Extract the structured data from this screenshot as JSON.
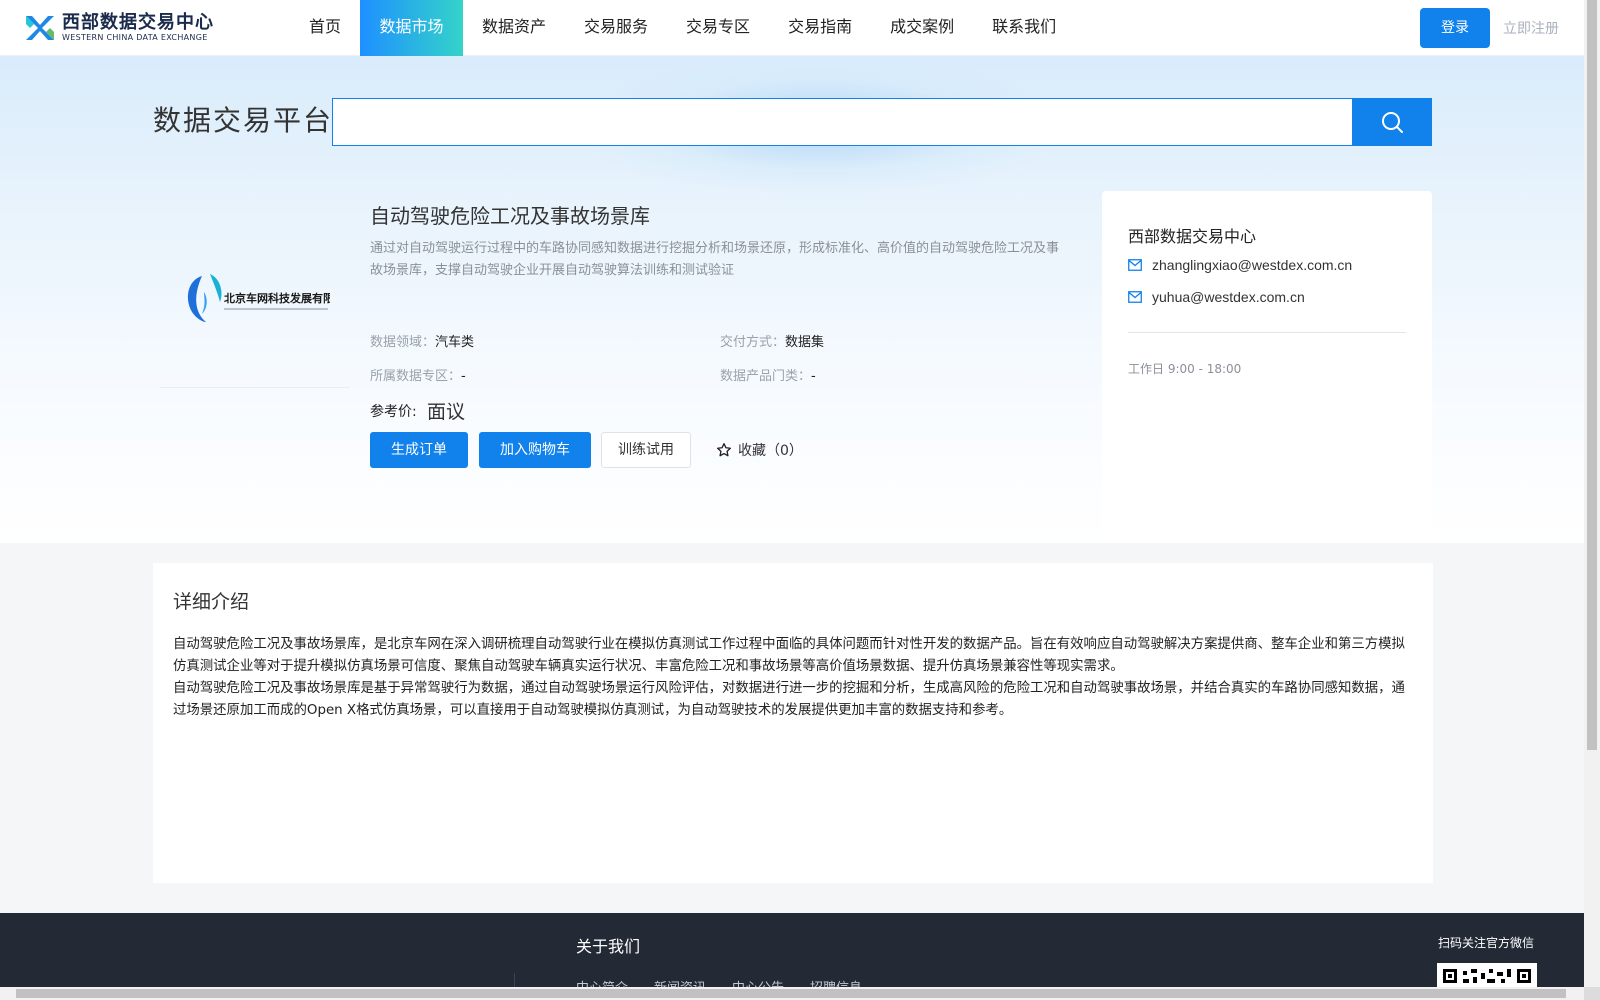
{
  "brand": {
    "name_cn": "西部数据交易中心",
    "name_en": "WESTERN CHINA DATA EXCHANGE"
  },
  "nav": {
    "items": [
      {
        "label": "首页",
        "active": false
      },
      {
        "label": "数据市场",
        "active": true
      },
      {
        "label": "数据资产",
        "active": false
      },
      {
        "label": "交易服务",
        "active": false
      },
      {
        "label": "交易专区",
        "active": false
      },
      {
        "label": "交易指南",
        "active": false
      },
      {
        "label": "成交案例",
        "active": false
      },
      {
        "label": "联系我们",
        "active": false
      }
    ]
  },
  "auth": {
    "login_label": "登录",
    "register_label": "立即注册"
  },
  "search": {
    "title": "数据交易平台",
    "value": "",
    "icon": "search-icon"
  },
  "provider": {
    "logo_text": "北京车网科技发展有限公司"
  },
  "product": {
    "title": "自动驾驶危险工况及事故场景库",
    "description": "通过对自动驾驶运行过程中的车路协同感知数据进行挖掘分析和场景还原，形成标准化、高价值的自动驾驶危险工况及事故场景库，支撑自动驾驶企业开展自动驾驶算法训练和测试验证",
    "attrs": {
      "domain_key": "数据领域：",
      "domain_val": "汽车类",
      "delivery_key": "交付方式：",
      "delivery_val": "数据集",
      "zone_key": "所属数据专区：",
      "zone_val": "-",
      "category_key": "数据产品门类：",
      "category_val": "-"
    },
    "price_label": "参考价:",
    "price_value": "面议",
    "buttons": {
      "order": "生成订单",
      "cart": "加入购物车",
      "trial": "训练试用"
    },
    "favorite": {
      "label": "收藏",
      "count": "（0）"
    }
  },
  "contact": {
    "name": "西部数据交易中心",
    "emails": [
      "zhanglingxiao@westdex.com.cn",
      "yuhua@westdex.com.cn"
    ],
    "hours": "工作日 9:00 - 18:00"
  },
  "detail": {
    "title": "详细介绍",
    "paragraphs": [
      "自动驾驶危险工况及事故场景库，是北京车网在深入调研梳理自动驾驶行业在模拟仿真测试工作过程中面临的具体问题而针对性开发的数据产品。旨在有效响应自动驾驶解决方案提供商、整车企业和第三方模拟仿真测试企业等对于提升模拟仿真场景可信度、聚焦自动驾驶车辆真实运行状况、丰富危险工况和事故场景等高价值场景数据、提升仿真场景兼容性等现实需求。",
      "自动驾驶危险工况及事故场景库是基于异常驾驶行为数据，通过自动驾驶场景运行风险评估，对数据进行进一步的挖掘和分析，生成高风险的危险工况和自动驾驶事故场景，并结合真实的车路协同感知数据，通过场景还原加工而成的Open X格式仿真场景，可以直接用于自动驾驶模拟仿真测试，为自动驾驶技术的发展提供更加丰富的数据支持和参考。"
    ]
  },
  "footer": {
    "about_title": "关于我们",
    "links": [
      "中心简介",
      "新闻资讯",
      "中心公告",
      "招聘信息"
    ],
    "qr_label": "扫码关注官方微信"
  },
  "colors": {
    "primary": "#1181ec",
    "accent_gradient_end": "#34d3c9",
    "footer_bg": "#232a35"
  }
}
